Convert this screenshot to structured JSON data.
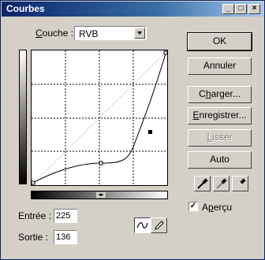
{
  "window": {
    "title": "Courbes"
  },
  "titlebar_buttons": {
    "minimize": "_",
    "maximize": "□",
    "close": "×"
  },
  "channel": {
    "label_prefix": "C",
    "label_rest": "ouche :",
    "value": "RVB"
  },
  "io": {
    "input_label": "Entrée :",
    "input_value": "225",
    "output_label": "Sortie :",
    "output_value": "136"
  },
  "buttons": {
    "ok": "OK",
    "cancel": "Annuler",
    "load_pre": "C",
    "load_u": "h",
    "load_post": "arger...",
    "save_pre": "",
    "save_u": "E",
    "save_post": "nregistrer...",
    "smooth_pre": "",
    "smooth_u": "L",
    "smooth_post": "isser",
    "auto": "Auto"
  },
  "preview": {
    "label_pre": "A",
    "label_u": "p",
    "label_post": "erçu",
    "checked": true
  },
  "icons": [
    "black-eyedropper-icon",
    "gray-eyedropper-icon",
    "white-eyedropper-icon",
    "curve-tool-icon",
    "pencil-tool-icon"
  ]
}
